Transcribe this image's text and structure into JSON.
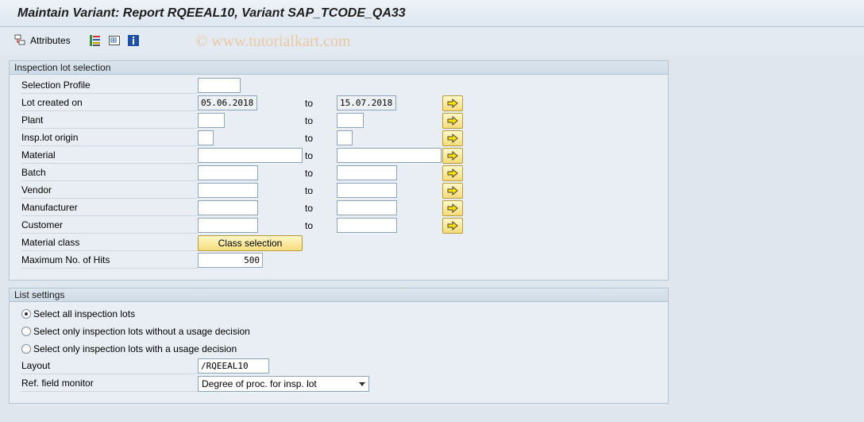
{
  "title": "Maintain Variant: Report RQEEAL10, Variant SAP_TCODE_QA33",
  "toolbar": {
    "attributes_label": "Attributes",
    "icons": [
      "attributes-icon",
      "selection-variables-icon",
      "expand-icon",
      "info-icon"
    ]
  },
  "watermark": "© www.tutorialkart.com",
  "inspection_group": {
    "title": "Inspection lot selection",
    "to_label": "to",
    "rows": [
      {
        "label": "Selection Profile",
        "low": "",
        "high": null
      },
      {
        "label": "Lot created on",
        "low": "05.06.2018",
        "high": "15.07.2018"
      },
      {
        "label": "Plant",
        "low": "",
        "high": ""
      },
      {
        "label": "Insp.lot origin",
        "low": "",
        "high": ""
      },
      {
        "label": "Material",
        "low": "",
        "high": ""
      },
      {
        "label": "Batch",
        "low": "",
        "high": ""
      },
      {
        "label": "Vendor",
        "low": "",
        "high": ""
      },
      {
        "label": "Manufacturer",
        "low": "",
        "high": ""
      },
      {
        "label": "Customer",
        "low": "",
        "high": ""
      },
      {
        "label": "Material class",
        "button": "Class selection"
      },
      {
        "label": "Maximum No. of Hits",
        "low": "500"
      }
    ]
  },
  "list_group": {
    "title": "List settings",
    "radios": [
      {
        "label": "Select all inspection lots",
        "selected": true
      },
      {
        "label": "Select only inspection lots without a usage decision",
        "selected": false
      },
      {
        "label": "Select only inspection lots with a usage decision",
        "selected": false
      }
    ],
    "layout_label": "Layout",
    "layout_value": "/RQEEAL10",
    "ref_label": "Ref. field monitor",
    "ref_value": "Degree of proc. for insp. lot"
  },
  "colors": {
    "background": "#dfe6ee",
    "group_bg": "#e8eef4",
    "button_yellow": "#f5dc78",
    "arrow_yellow": "#ffe000"
  }
}
